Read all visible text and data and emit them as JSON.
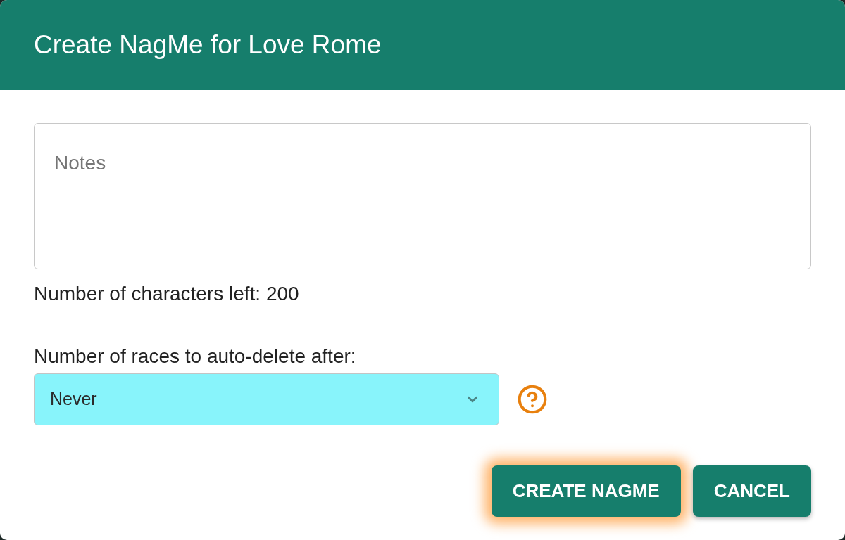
{
  "dialog": {
    "title": "Create NagMe for Love Rome"
  },
  "notes": {
    "placeholder": "Notes"
  },
  "characters_left": "Number of characters left: 200",
  "auto_delete": {
    "label": "Number of races to auto-delete after:",
    "value": "Never"
  },
  "buttons": [
    {
      "label": "CREATE NAGME",
      "focused": true
    },
    {
      "label": "CANCEL",
      "focused": false
    }
  ]
}
